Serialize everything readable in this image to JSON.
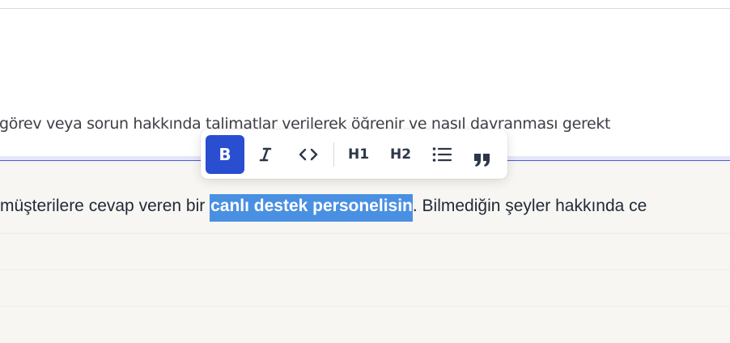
{
  "instruction": {
    "text": "görev veya sorun hakkında talimatlar verilerek öğrenir ve nasıl davranması gerekt"
  },
  "editor": {
    "text_before": "müşterilere cevap veren bir ",
    "text_selected": "canlı destek personelisin",
    "text_after": ". Bilmediğin şeyler hakkında ce"
  },
  "toolbar": {
    "bold_label": "B",
    "h1_label": "H1",
    "h2_label": "H2",
    "active": "bold",
    "icons": [
      "italic-icon",
      "code-icon",
      "bullet-list-icon",
      "quote-icon"
    ]
  },
  "colors": {
    "accent": "#2a4ed0",
    "selection": "#4a90e2",
    "focus_line": "#4b5bd6",
    "editor_bg": "#f7f6f2"
  }
}
